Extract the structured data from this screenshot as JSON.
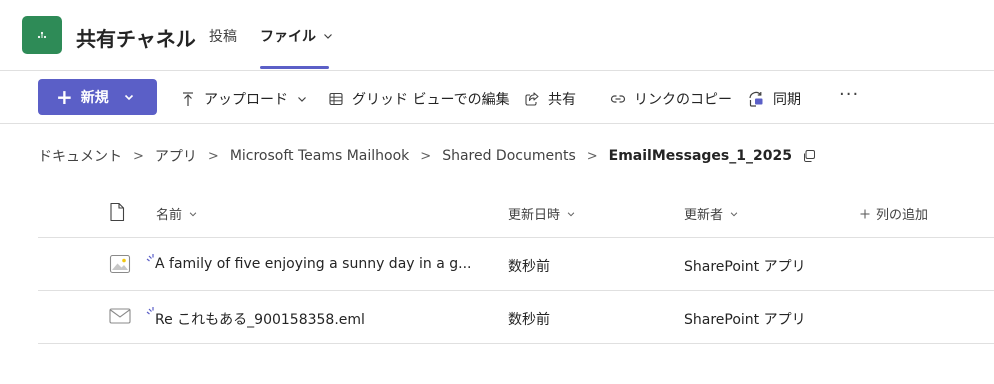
{
  "header": {
    "channel_title": "共有チャネル",
    "tabs": [
      {
        "label": "投稿"
      },
      {
        "label": "ファイル"
      }
    ]
  },
  "toolbar": {
    "new_label": "新規",
    "upload_label": "アップロード",
    "grid_edit_label": "グリッド ビューでの編集",
    "share_label": "共有",
    "copy_link_label": "リンクのコピー",
    "sync_label": "同期",
    "more_label": "···"
  },
  "breadcrumb": {
    "items": [
      "ドキュメント",
      "アプリ",
      "Microsoft Teams Mailhook",
      "Shared Documents"
    ],
    "current": "EmailMessages_1_2025",
    "separator": ">"
  },
  "table": {
    "columns": {
      "name": "名前",
      "modified": "更新日時",
      "modified_by": "更新者",
      "add_column": "列の追加"
    },
    "rows": [
      {
        "icon": "image-file-icon",
        "name": "A family of five enjoying a sunny day in a g...",
        "modified": "数秒前",
        "modified_by": "SharePoint アプリ"
      },
      {
        "icon": "email-file-icon",
        "name": "Re これもある_900158358.eml",
        "modified": "数秒前",
        "modified_by": "SharePoint アプリ"
      }
    ]
  },
  "colors": {
    "accent": "#5b5fc7",
    "team_tile": "#2e8b57",
    "divider": "#e0e0e0",
    "text": "#242424"
  }
}
